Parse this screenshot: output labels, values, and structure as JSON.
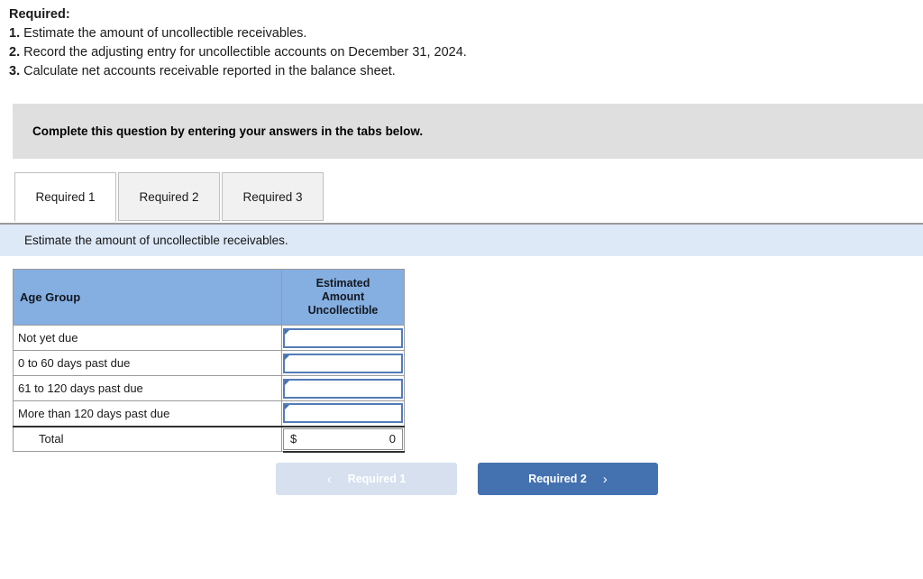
{
  "intro": {
    "title": "Required:",
    "items": [
      {
        "num": "1.",
        "text": "Estimate the amount of uncollectible receivables."
      },
      {
        "num": "2.",
        "text": "Record the adjusting entry for uncollectible accounts on December 31, 2024."
      },
      {
        "num": "3.",
        "text": "Calculate net accounts receivable reported in the balance sheet."
      }
    ]
  },
  "banner": {
    "text": "Complete this question by entering your answers in the tabs below."
  },
  "tabs": [
    {
      "label": "Required 1",
      "active": true
    },
    {
      "label": "Required 2",
      "active": false
    },
    {
      "label": "Required 3",
      "active": false
    }
  ],
  "subtitle": {
    "text": "Estimate the amount of uncollectible receivables."
  },
  "table": {
    "headers": {
      "age_group": "Age Group",
      "estimated_amount_uncollectible": "Estimated\nAmount\nUncollectible",
      "estimated_line1": "Estimated",
      "estimated_line2": "Amount",
      "estimated_line3": "Uncollectible"
    },
    "rows": [
      {
        "label": "Not yet due",
        "value": ""
      },
      {
        "label": "0 to 60 days past due",
        "value": ""
      },
      {
        "label": "61 to 120 days past due",
        "value": ""
      },
      {
        "label": "More than 120 days past due",
        "value": ""
      }
    ],
    "total": {
      "label": "Total",
      "currency": "$",
      "value": "0"
    }
  },
  "nav": {
    "prev": {
      "label": "Required 1",
      "chevron": "‹",
      "disabled": true
    },
    "next": {
      "label": "Required 2",
      "chevron": "›",
      "disabled": false
    }
  },
  "colors": {
    "header_blue": "#85aee1",
    "banner_gray": "#dfdfdf",
    "subtitle_blue": "#dee9f7",
    "button_blue": "#4472b0",
    "button_disabled": "#d6e0ef",
    "input_border": "#537cb8"
  }
}
